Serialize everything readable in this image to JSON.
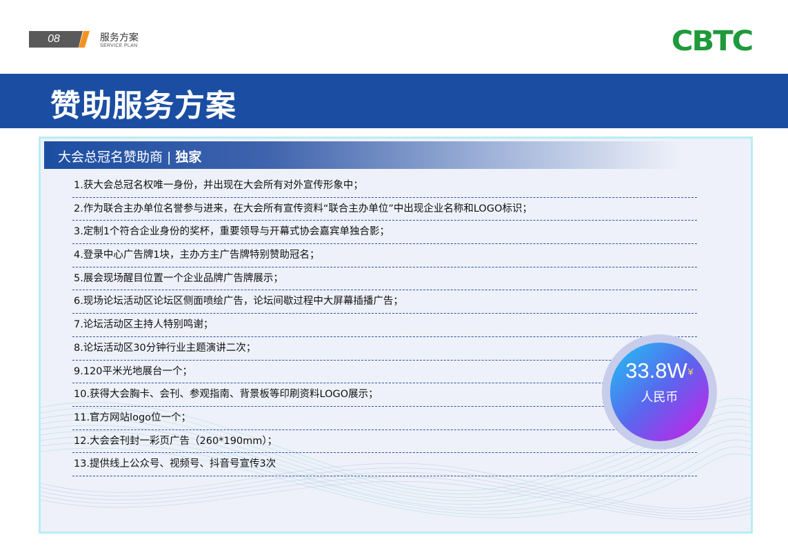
{
  "header": {
    "page_number": "08",
    "section_title_cn": "服务方案",
    "section_title_en": "SERVICE PLAN",
    "logo_text": "CBTC"
  },
  "title": "赞助服务方案",
  "card": {
    "heading": "大会总冠名赞助商",
    "separator": "|",
    "heading_tag": "独家",
    "items": [
      "1.获大会总冠名权唯一身份，并出现在大会所有对外宣传形象中；",
      "2.作为联合主办单位名誉参与进来，在大会所有宣传资料“联合主办单位”中出现企业名称和LOGO标识；",
      "3.定制1个符合企业身份的奖杯，重要领导与开幕式协会嘉宾单独合影；",
      "4.登录中心广告牌1块，主办方主广告牌特别赞助冠名；",
      "5.展会现场醒目位置一个企业品牌广告牌展示；",
      "6.现场论坛活动区论坛区侧面喷绘广告，论坛间歇过程中大屏幕插播广告；",
      "7.论坛活动区主持人特别鸣谢；",
      "8.论坛活动区30分钟行业主题演讲二次；",
      "9.120平米光地展台一个；",
      "10.获得大会胸卡、会刊、参观指南、背景板等印刷资料LOGO展示；",
      "11.官方网站logo位一个；",
      "12.大会会刊封一彩页广告（260*190mm）；",
      "13.提供线上公众号、视频号、抖音号宣传3次"
    ]
  },
  "price": {
    "amount": "33.8W",
    "currency_symbol": "¥",
    "unit": "人民币"
  },
  "colors": {
    "brand_blue": "#1b4ea2",
    "logo_green": "#1e9a3a",
    "accent_orange": "#f5921e",
    "badge_gradient_start": "#1fc3f3",
    "badge_gradient_end": "#d31ae8"
  }
}
